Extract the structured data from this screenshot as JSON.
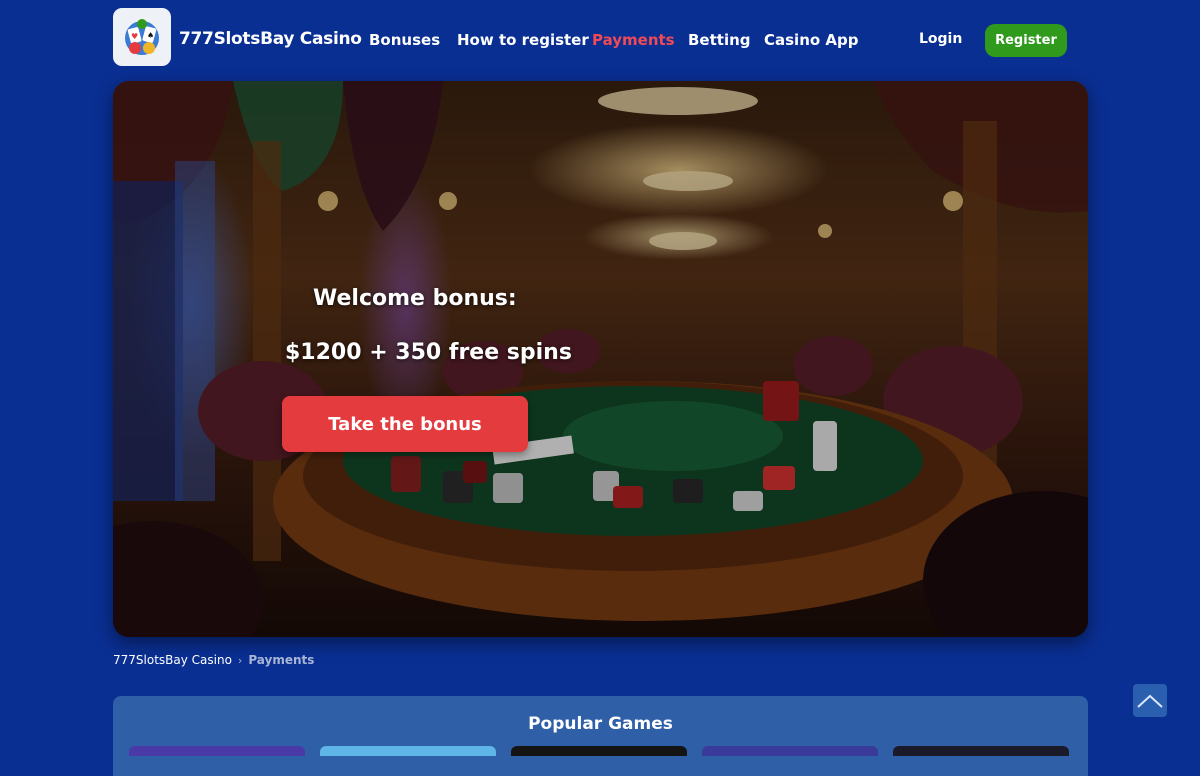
{
  "header": {
    "brand": "777SlotsBay Casino",
    "nav": [
      {
        "label": "Bonuses",
        "active": false
      },
      {
        "label": "How to register",
        "active": false
      },
      {
        "label": "Payments",
        "active": true
      },
      {
        "label": "Betting",
        "active": false
      },
      {
        "label": "Casino App",
        "active": false
      }
    ],
    "login_label": "Login",
    "register_label": "Register"
  },
  "hero": {
    "title": "Welcome bonus:",
    "subtitle": "$1200 + 350 free spins",
    "cta_label": "Take the bonus"
  },
  "breadcrumb": {
    "home": "777SlotsBay Casino",
    "separator": "›",
    "current": "Payments"
  },
  "popular": {
    "title": "Popular Games"
  },
  "colors": {
    "background": "#0a2f93",
    "accent_red": "#e43c3e",
    "active_nav": "#ef4a55",
    "register_green": "#2f9a1b",
    "panel_blue": "#2f5fa7"
  },
  "icons": {
    "logo": "casino-logo-icon",
    "scroll_top": "chevron-up-icon"
  }
}
